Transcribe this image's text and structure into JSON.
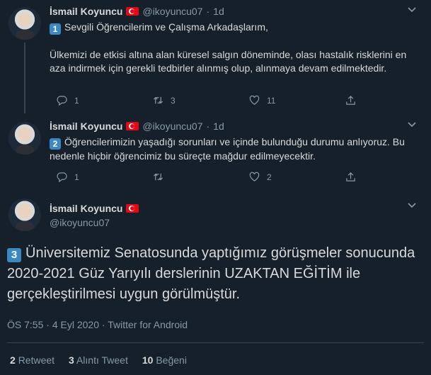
{
  "tweets": [
    {
      "name": "İsmail Koyuncu",
      "handle": "@ikoyuncu07",
      "dot": "·",
      "time": "1d",
      "badge": "1",
      "line1": "Sevgili Öğrencilerim ve Çalışma Arkadaşlarım,",
      "para": "Ülkemizi de etkisi altına alan küresel salgın döneminde, olası hastalık risklerini en aza indirmek için gerekli tedbirler alınmış olup, alınmaya devam edilmektedir.",
      "replies": "1",
      "retweets": "3",
      "likes": "11"
    },
    {
      "name": "İsmail Koyuncu",
      "handle": "@ikoyuncu07",
      "dot": "·",
      "time": "1d",
      "badge": "2",
      "para": "Öğrencilerimizin yaşadığı sorunları ve içinde bulunduğu durumu anlıyoruz. Bu nedenle hiçbir öğrencimiz bu süreçte mağdur edilmeyecektir.",
      "replies": "1",
      "retweets": "",
      "likes": "2"
    }
  ],
  "main": {
    "name": "İsmail Koyuncu",
    "handle": "@ikoyuncu07",
    "badge": "3",
    "text": "Üniversitemiz Senatosunda  yaptığımız görüşmeler sonucunda 2020-2021 Güz Yarıyılı derslerinin UZAKTAN EĞİTİM ile gerçekleştirilmesi uygun görülmüştür.",
    "time": "ÖS 7:55",
    "date": "4 Eyl 2020",
    "source": "Twitter for Android",
    "sep": "·",
    "retweet_count": "2",
    "retweet_label": "Retweet",
    "quote_count": "3",
    "quote_label": "Alıntı Tweet",
    "like_count": "10",
    "like_label": "Beğeni"
  },
  "icons": [
    "reply-icon",
    "retweet-icon",
    "like-icon",
    "share-icon",
    "chevron-down-icon",
    "turkey-flag-icon"
  ],
  "colors": {
    "background": "#15202b",
    "text": "#d9d9d9",
    "muted": "#8899a6",
    "border": "#38444d",
    "keycap": "#3b88c3"
  }
}
